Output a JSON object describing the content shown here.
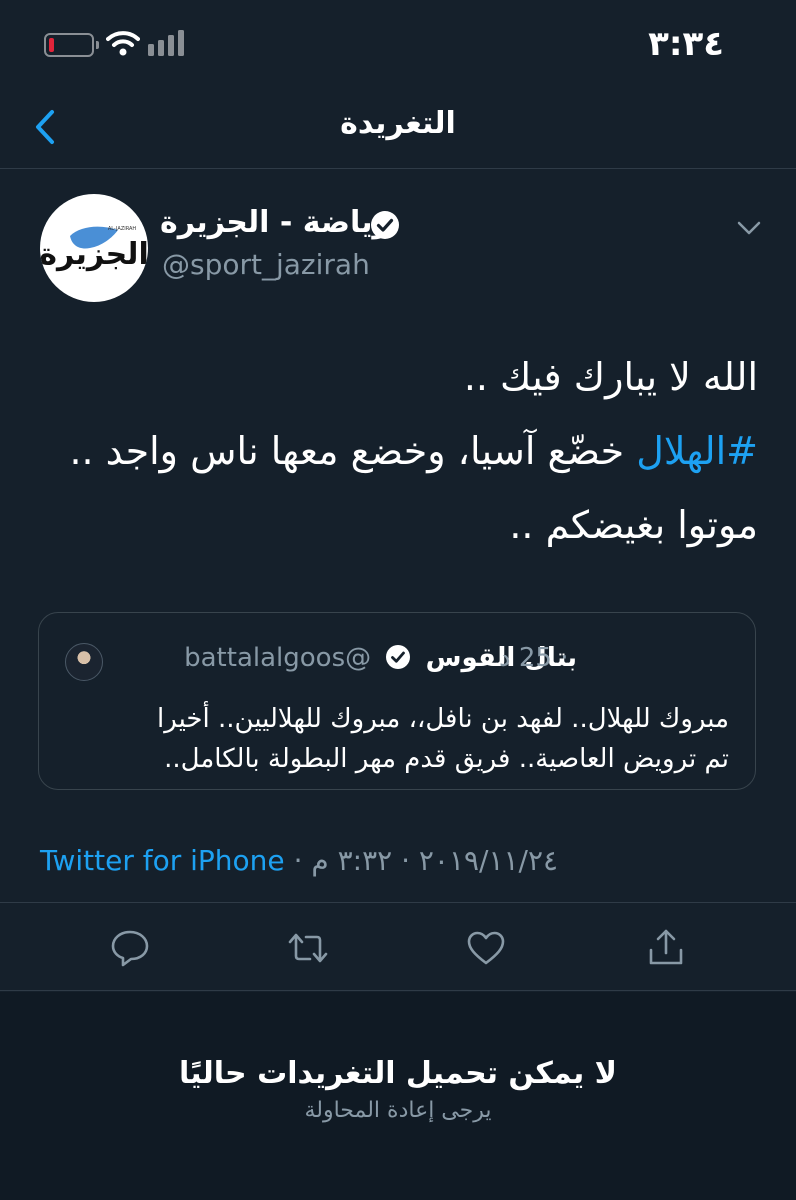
{
  "status_bar": {
    "time": "٣:٣٤",
    "battery_level_fraction": 0.12,
    "battery_color": "#e0243a"
  },
  "header": {
    "title": "التغريدة",
    "back_icon": "chevron-left-icon"
  },
  "tweet": {
    "author": {
      "display_name": "رياضة - الجزيرة",
      "username": "@sport_jazirah",
      "verified": true,
      "avatar_logo_text": "الجزيرة",
      "avatar_logo_latin": "AL-JAZIRAH"
    },
    "body": {
      "line1": "الله لا يبارك فيك ..",
      "hashtag": "#الهلال",
      "line2_rest": " خضّع آسيا، وخضع معها ناس واجد ..",
      "line3": "موتوا بغيضكم .."
    },
    "quote": {
      "display_name": "بتال القوس",
      "handle": "@battalalgoos",
      "time": "· 25 د",
      "verified": true,
      "line1": "مبروك للهلال.. لفهد بن نافل،، مبروك للهلاليين.. أخيرا",
      "line2": "تم ترويض العاصية.. فريق قدم مهر البطولة بالكامل.."
    },
    "meta": {
      "time": "٣:٣٢ م",
      "separator": " · ",
      "date": "٢٠١٩/١١/٢٤",
      "source": "Twitter for iPhone"
    },
    "actions": [
      "reply-icon",
      "retweet-icon",
      "like-icon",
      "share-icon"
    ]
  },
  "error": {
    "title": "لا يمكن تحميل التغريدات حاليًا",
    "subtitle": "يرجى إعادة المحاولة"
  },
  "colors": {
    "background": "#15202b",
    "accent": "#1da1f2",
    "secondary_text": "#8899a6",
    "divider": "#2f3b47"
  }
}
